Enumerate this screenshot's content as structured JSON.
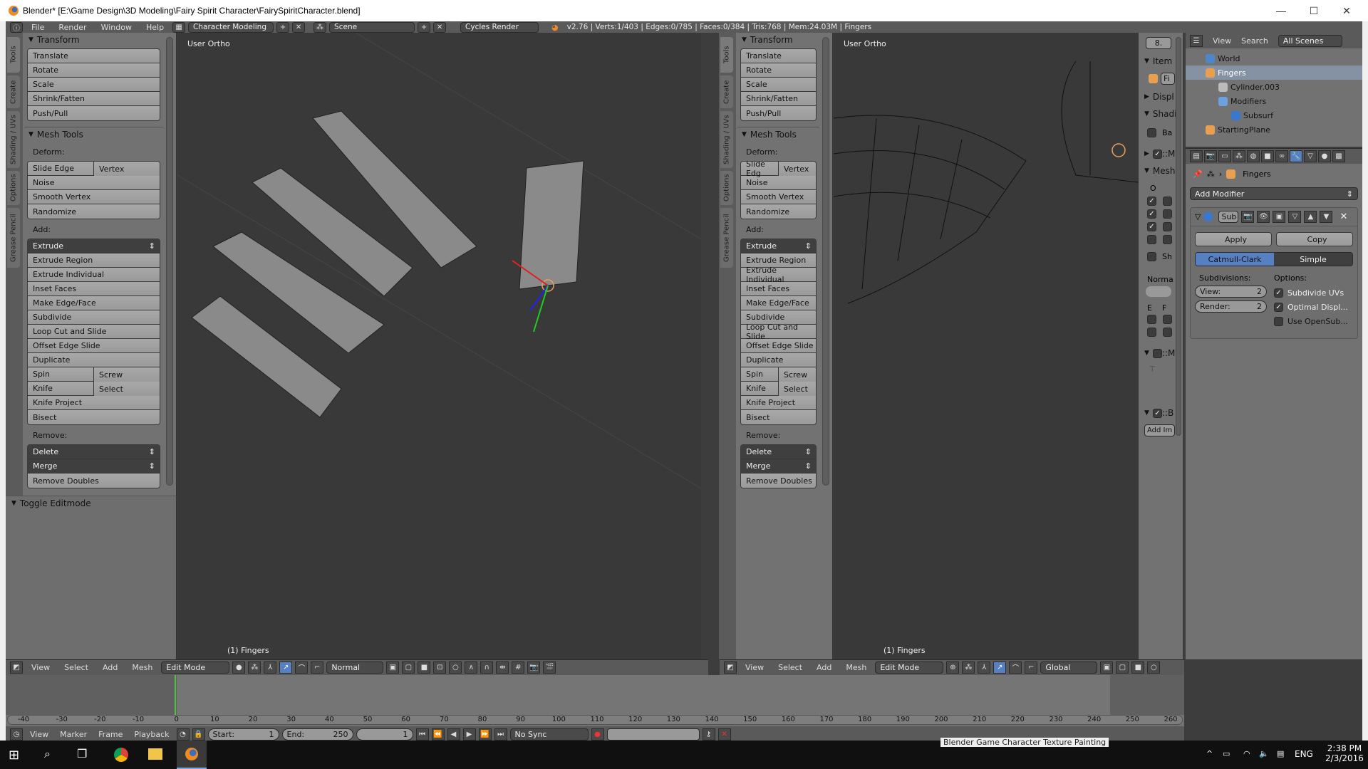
{
  "window": {
    "title": "Blender* [E:\\Game Design\\3D Modeling\\Fairy Spirit Character\\FairySpiritCharacter.blend]",
    "controls": [
      "—",
      "☐",
      "✕"
    ]
  },
  "infobar": {
    "menus": [
      "File",
      "Render",
      "Window",
      "Help"
    ],
    "layout": "Character Modeling",
    "scene": "Scene",
    "engine": "Cycles Render",
    "stats": "v2.76 | Verts:1/403 | Edges:0/785 | Faces:0/384 | Tris:768 | Mem:24.03M | Fingers"
  },
  "toolshelf": {
    "tabs": [
      "Tools",
      "Create",
      "Shading / UVs",
      "Options",
      "Grease Pencil"
    ],
    "transform_title": "Transform",
    "transform_buttons": [
      "Translate",
      "Rotate",
      "Scale",
      "Shrink/Fatten",
      "Push/Pull"
    ],
    "mesh_tools_title": "Mesh Tools",
    "deform_label": "Deform:",
    "deform_pair_left": "Slide Edge",
    "deform_pair_left_short": "Slide Edg",
    "deform_pair_right": "Vertex",
    "deform_buttons": [
      "Noise",
      "Smooth Vertex",
      "Randomize"
    ],
    "add_label": "Add:",
    "extrude_select": "Extrude",
    "add_buttons": [
      "Extrude Region",
      "Extrude Individual",
      "Inset Faces",
      "Make Edge/Face",
      "Subdivide",
      "Loop Cut and Slide",
      "Offset Edge Slide",
      "Duplicate"
    ],
    "spin": "Spin",
    "screw": "Screw",
    "knife": "Knife",
    "select": "Select",
    "add_buttons2": [
      "Knife Project",
      "Bisect"
    ],
    "remove_label": "Remove:",
    "delete_select": "Delete",
    "merge_select": "Merge",
    "remove_doubles": "Remove Doubles",
    "toggle_editmode": "Toggle Editmode"
  },
  "viewport_left": {
    "label": "User Ortho",
    "object": "(1) Fingers"
  },
  "viewport_right": {
    "label": "User Ortho",
    "object": "(1) Fingers"
  },
  "view3d_header_left": {
    "menus": [
      "View",
      "Select",
      "Add",
      "Mesh"
    ],
    "mode": "Edit Mode",
    "orientation": "Normal"
  },
  "view3d_header_right": {
    "menus": [
      "View",
      "Select",
      "Add",
      "Mesh"
    ],
    "mode": "Edit Mode",
    "orientation": "Global"
  },
  "npanel": {
    "value": "8.",
    "item": "Item",
    "item_name": "Fi",
    "display": "Displ",
    "shading": "Shadi",
    "ba": "Ba",
    "m1": "::M",
    "mesh": "Mesh",
    "o": "O",
    "sh": "Sh",
    "normals": "Norma",
    "e": "E",
    "f": "F",
    "m2": "::M",
    "t": "T",
    "b": "::B",
    "add_image": "Add Im"
  },
  "outliner": {
    "menus": [
      "View",
      "Search"
    ],
    "filter": "All Scenes",
    "items": [
      {
        "label": "World",
        "indent": 1,
        "icon": "world"
      },
      {
        "label": "Fingers",
        "indent": 1,
        "icon": "mesh-object",
        "selected": true
      },
      {
        "label": "Cylinder.003",
        "indent": 2,
        "icon": "mesh-data"
      },
      {
        "label": "Modifiers",
        "indent": 2,
        "icon": "wrench"
      },
      {
        "label": "Subsurf",
        "indent": 3,
        "icon": "modifier"
      },
      {
        "label": "StartingPlane",
        "indent": 1,
        "icon": "mesh-object"
      }
    ]
  },
  "properties": {
    "object_name": "Fingers",
    "add_modifier": "Add Modifier",
    "modifier_name": "Sub",
    "apply": "Apply",
    "copy": "Copy",
    "type_options": [
      "Catmull-Clark",
      "Simple"
    ],
    "type_selected": "Catmull-Clark",
    "subdivisions_label": "Subdivisions:",
    "options_label": "Options:",
    "view_label": "View:",
    "view_value": "2",
    "render_label": "Render:",
    "render_value": "2",
    "subdivide_uvs": "Subdivide UVs",
    "subdivide_uvs_checked": true,
    "optimal_display": "Optimal Displ...",
    "optimal_display_checked": true,
    "use_opensubdiv": "Use OpenSub...",
    "use_opensubdiv_checked": false
  },
  "timeline": {
    "ticks": [
      "-40",
      "-30",
      "-20",
      "-10",
      "0",
      "10",
      "20",
      "30",
      "40",
      "50",
      "60",
      "70",
      "80",
      "90",
      "100",
      "110",
      "120",
      "130",
      "140",
      "150",
      "160",
      "170",
      "180",
      "190",
      "200",
      "210",
      "220",
      "230",
      "240",
      "250",
      "260"
    ],
    "menus": [
      "View",
      "Marker",
      "Frame",
      "Playback"
    ],
    "start_label": "Start:",
    "start": "1",
    "end_label": "End:",
    "end": "250",
    "current_frame": "1",
    "sync": "No Sync",
    "current_frame_marker": 0
  },
  "taskbar": {
    "time": "2:38 PM",
    "date": "2/3/2016",
    "lang": "ENG",
    "hidden_window_title": "Blender Game Character Texture Painting"
  }
}
